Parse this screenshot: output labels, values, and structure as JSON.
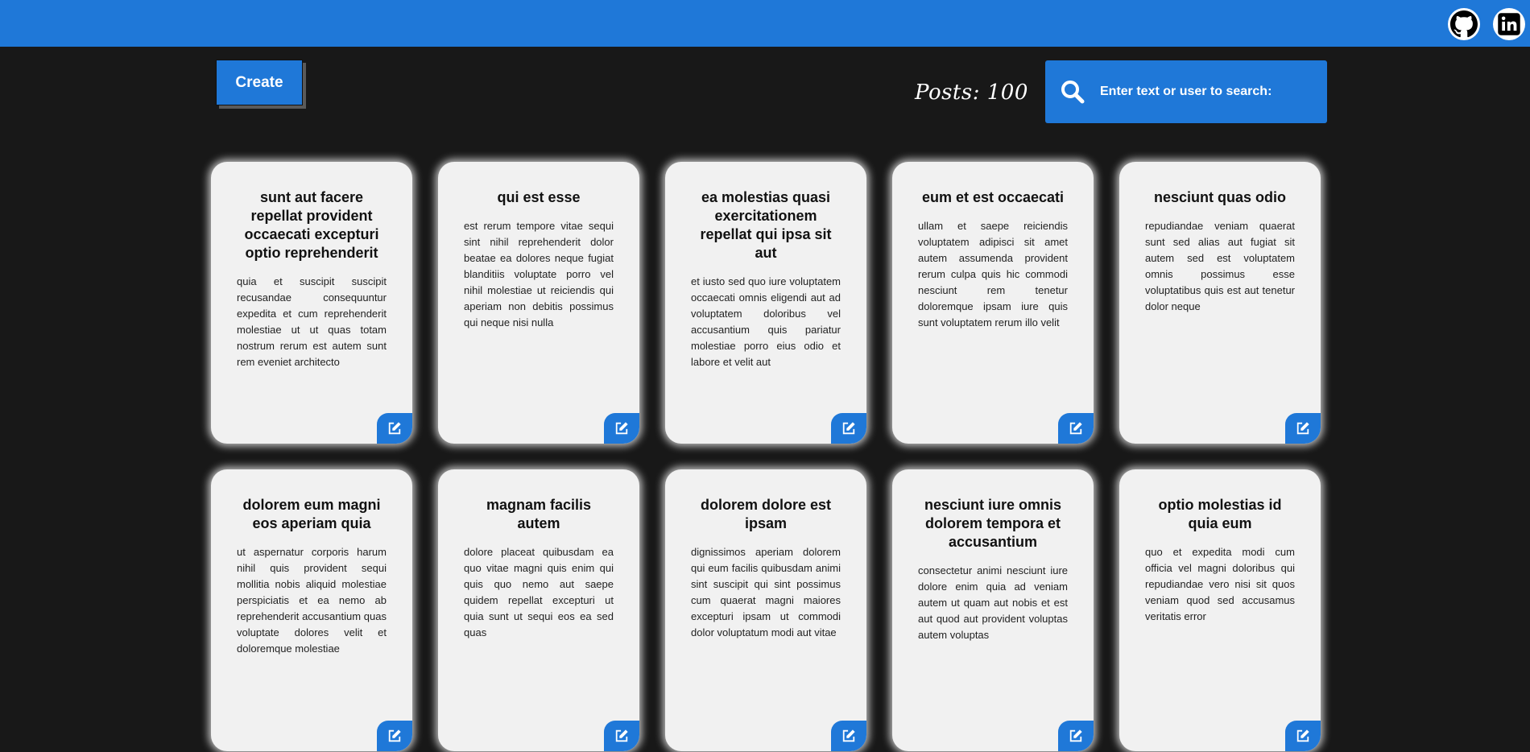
{
  "header": {
    "social": [
      {
        "icon": "github-icon"
      },
      {
        "icon": "linkedin-icon"
      }
    ]
  },
  "toolbar": {
    "create_label": "Create",
    "posts_label": "Posts: 100",
    "search_placeholder": "Enter text or user to search:"
  },
  "posts": [
    {
      "title": "sunt aut facere repellat provident occaecati excepturi optio reprehenderit",
      "body": "quia et suscipit suscipit recusandae consequuntur expedita et cum reprehenderit molestiae ut ut quas totam nostrum rerum est autem sunt rem eveniet architecto"
    },
    {
      "title": "qui est esse",
      "body": "est rerum tempore vitae sequi sint nihil reprehenderit dolor beatae ea dolores neque fugiat blanditiis voluptate porro vel nihil molestiae ut reiciendis qui aperiam non debitis possimus qui neque nisi nulla"
    },
    {
      "title": "ea molestias quasi exercitationem repellat qui ipsa sit aut",
      "body": "et iusto sed quo iure voluptatem occaecati omnis eligendi aut ad voluptatem doloribus vel accusantium quis pariatur molestiae porro eius odio et labore et velit aut"
    },
    {
      "title": "eum et est occaecati",
      "body": "ullam et saepe reiciendis voluptatem adipisci sit amet autem assumenda provident rerum culpa quis hic commodi nesciunt rem tenetur doloremque ipsam iure quis sunt voluptatem rerum illo velit"
    },
    {
      "title": "nesciunt quas odio",
      "body": "repudiandae veniam quaerat sunt sed alias aut fugiat sit autem sed est voluptatem omnis possimus esse voluptatibus quis est aut tenetur dolor neque"
    },
    {
      "title": "dolorem eum magni eos aperiam quia",
      "body": "ut aspernatur corporis harum nihil quis provident sequi mollitia nobis aliquid molestiae perspiciatis et ea nemo ab reprehenderit accusantium quas voluptate dolores velit et doloremque molestiae"
    },
    {
      "title": "magnam facilis autem",
      "body": "dolore placeat quibusdam ea quo vitae magni quis enim qui quis quo nemo aut saepe quidem repellat excepturi ut quia sunt ut sequi eos ea sed quas"
    },
    {
      "title": "dolorem dolore est ipsam",
      "body": "dignissimos aperiam dolorem qui eum facilis quibusdam animi sint suscipit qui sint possimus cum quaerat magni maiores excepturi ipsam ut commodi dolor voluptatum modi aut vitae"
    },
    {
      "title": "nesciunt iure omnis dolorem tempora et accusantium",
      "body": "consectetur animi nesciunt iure dolore enim quia ad veniam autem ut quam aut nobis et est aut quod aut provident voluptas autem voluptas"
    },
    {
      "title": "optio molestias id quia eum",
      "body": "quo et expedita modi cum officia vel magni doloribus qui repudiandae vero nisi sit quos veniam quod sed accusamus veritatis error"
    }
  ],
  "colors": {
    "accent": "#1f78d8",
    "background": "#181818",
    "card": "#f1f1f1"
  }
}
